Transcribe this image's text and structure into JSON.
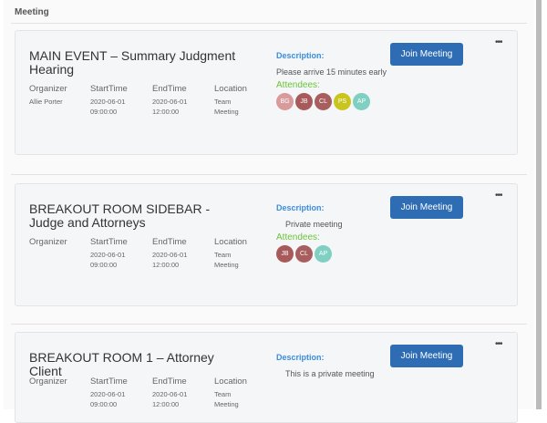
{
  "header": {
    "title": "Meeting"
  },
  "labels": {
    "organizer": "Organizer",
    "start": "StartTime",
    "end": "EndTime",
    "location": "Location",
    "description": "Description:",
    "attendees": "Attendees:",
    "join": "Join Meeting",
    "more": "•••"
  },
  "meetings": [
    {
      "title": "MAIN EVENT – Summary Judgment Hearing",
      "organizer": "Allie Porter",
      "start_date": "2020-06-01",
      "start_time": "09:00:00",
      "end_date": "2020-06-01",
      "end_time": "12:00:00",
      "location_1": "Team",
      "location_2": "Meeting",
      "description": "Please arrive 15 minutes early",
      "attendees": [
        {
          "initials": "BG",
          "color": "#d89a9a"
        },
        {
          "initials": "JB",
          "color": "#a85a5a"
        },
        {
          "initials": "CL",
          "color": "#a85e5e"
        },
        {
          "initials": "PS",
          "color": "#c9c41e"
        },
        {
          "initials": "AP",
          "color": "#7fd0c2"
        }
      ]
    },
    {
      "title": "BREAKOUT ROOM SIDEBAR - Judge and Attorneys",
      "organizer": "",
      "start_date": "2020-06-01",
      "start_time": "09:00:00",
      "end_date": "2020-06-01",
      "end_time": "12:00:00",
      "location_1": "Team",
      "location_2": "Meeting",
      "description": "Private meeting",
      "attendees": [
        {
          "initials": "JB",
          "color": "#a85a5a"
        },
        {
          "initials": "CL",
          "color": "#a85e5e"
        },
        {
          "initials": "AP",
          "color": "#7fd0c2"
        }
      ]
    },
    {
      "title": "BREAKOUT ROOM 1 – Attorney Client",
      "organizer": "",
      "start_date": "2020-06-01",
      "start_time": "09:00:00",
      "end_date": "2020-06-01",
      "end_time": "12:00:00",
      "location_1": "Team",
      "location_2": "Meeting",
      "description": "This is a private meeting",
      "attendees": []
    }
  ]
}
